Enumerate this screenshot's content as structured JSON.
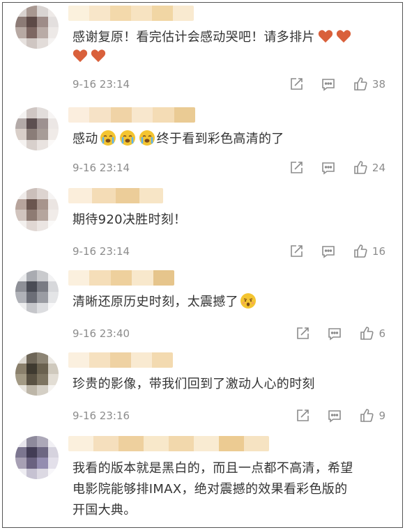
{
  "colors": {
    "text": "#333333",
    "meta": "#8c8c8c",
    "heart": "#d9603b",
    "emoji": "#f4c531"
  },
  "comments": [
    {
      "text": "感谢复原！看完估计会感动哭吧！请多排片",
      "reaction_icons": [
        "heart-icon",
        "heart-icon",
        "heart-icon",
        "heart-icon"
      ],
      "time": "9-16 23:14",
      "likes": "38"
    },
    {
      "text_before": "感动",
      "text_after": "终于看到彩色高清的了",
      "reaction_icons": [
        "crying-face-icon",
        "crying-face-icon",
        "crying-face-icon"
      ],
      "time": "9-16 23:14",
      "likes": "24"
    },
    {
      "text": "期待920决胜时刻！",
      "time": "9-16 23:14",
      "likes": "16"
    },
    {
      "text": "清晰还原历史时刻，太震撼了",
      "reaction_icons": [
        "astonished-face-icon"
      ],
      "time": "9-16 23:40",
      "likes": "6"
    },
    {
      "text": "珍贵的影像，带我们回到了激动人心的时刻",
      "time": "9-16 23:16",
      "likes": "9"
    },
    {
      "text_lines": [
        "我看的版本就是黑白的，而且一点都不高清，希望",
        "电影院能够排IMAX，绝对震撼的效果看彩色版的",
        "开国大典。"
      ]
    }
  ]
}
